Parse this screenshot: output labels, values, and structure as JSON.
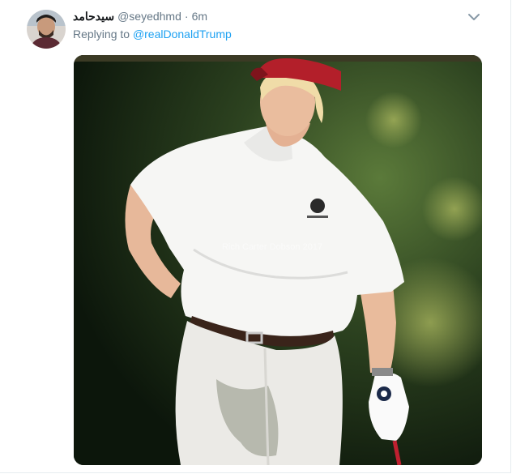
{
  "tweet": {
    "display_name": "سیدحامد",
    "handle": "@seyedhmd",
    "separator": "·",
    "time": "6m",
    "reply_prefix": "Replying to",
    "reply_mention": "@realDonaldTrump"
  },
  "media": {
    "watermark": "Rich Carter Dobson 2017"
  },
  "icons": {
    "menu": "chevron-down-icon"
  },
  "colors": {
    "link": "#1da1f2",
    "secondary_text": "#657786",
    "name_text": "#14171a"
  }
}
